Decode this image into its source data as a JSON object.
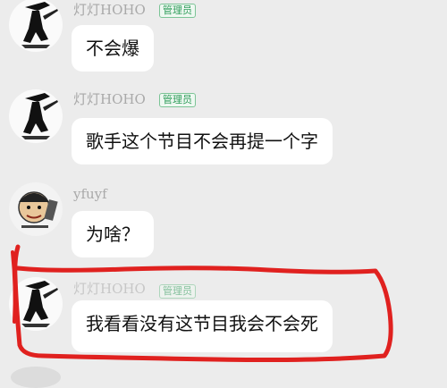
{
  "messages": [
    {
      "sender": "灯灯HOHO",
      "badge": "管理员",
      "text": "不会爆",
      "avatar_icon": "ink-swordsman-avatar-icon"
    },
    {
      "sender": "灯灯HOHO",
      "badge": "管理员",
      "text": "歌手这个节目不会再提一个字",
      "avatar_icon": "ink-swordsman-avatar-icon"
    },
    {
      "sender": "yfuyf",
      "text": "为啥？",
      "avatar_icon": "meme-face-avatar-icon"
    },
    {
      "sender": "灯灯HOHO",
      "badge": "管理员",
      "text": "我看看没有这节目我会不会死",
      "avatar_icon": "ink-swordsman-avatar-icon"
    }
  ],
  "colors": {
    "background": "#ececec",
    "bubble": "#ffffff",
    "badge_text": "#2f9c5a",
    "annotation": "#e0211f"
  }
}
